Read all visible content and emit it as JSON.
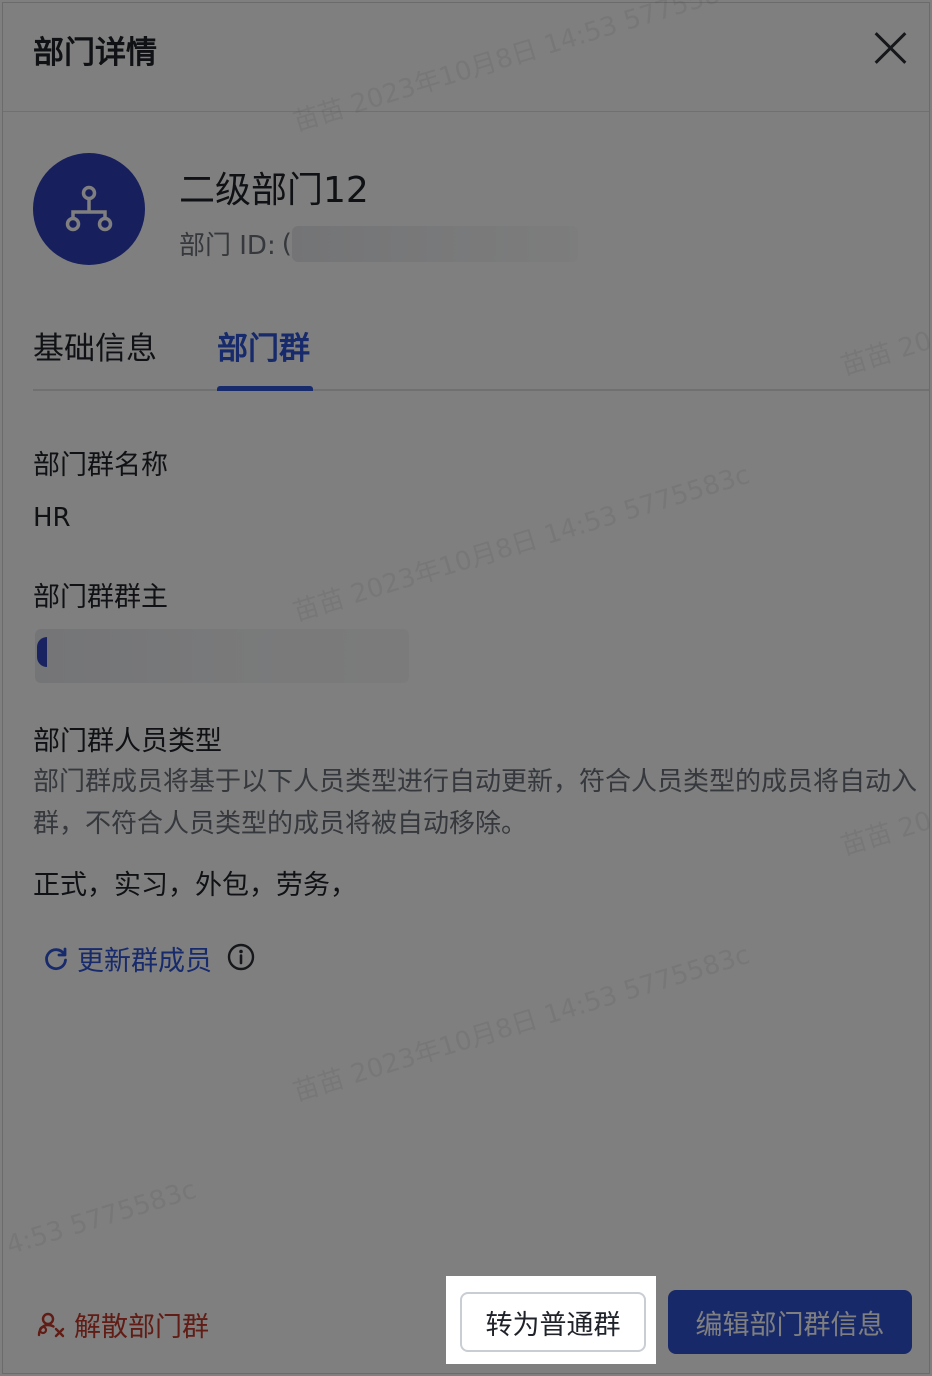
{
  "header": {
    "title": "部门详情",
    "close_icon": "close-icon"
  },
  "department": {
    "avatar_icon": "org-tree-icon",
    "name": "二级部门12",
    "id_label": "部门 ID:",
    "id_value": "("
  },
  "tabs": [
    {
      "label": "基础信息",
      "active": false
    },
    {
      "label": "部门群",
      "active": true
    }
  ],
  "group": {
    "name_label": "部门群名称",
    "name_value": "HR",
    "owner_label": "部门群群主",
    "member_type_label": "部门群人员类型",
    "member_type_desc": "部门群成员将基于以下人员类型进行自动更新，符合人员类型的成员将自动入群，不符合人员类型的成员将被自动移除。",
    "member_types": "正式，实习，外包，劳务，",
    "refresh_label": "更新群成员"
  },
  "footer": {
    "disband_label": "解散部门群",
    "convert_label": "转为普通群",
    "edit_label": "编辑部门群信息"
  },
  "watermark": {
    "text": "苗苗 2023年10月8日 14:53 5775583c",
    "fragment_right": "苗苗 20",
    "fragment_left": "4:53 5775583c"
  },
  "colors": {
    "accent": "#2e55d6",
    "primary_button": "#3153d3",
    "danger": "#c0392b",
    "avatar_bg": "#2f3eb8"
  }
}
